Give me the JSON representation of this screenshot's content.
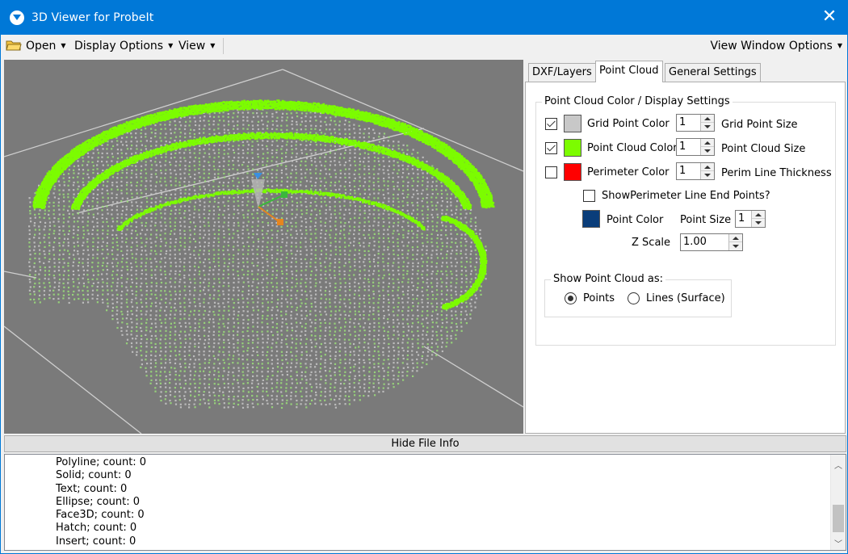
{
  "window": {
    "title": "3D Viewer for ProbeIt",
    "close_glyph": "✕"
  },
  "menu": {
    "open": "Open",
    "display_options": "Display Options",
    "view": "View",
    "view_window_options": "View Window Options"
  },
  "tabs": [
    {
      "label": "DXF/Layers"
    },
    {
      "label": "Point Cloud"
    },
    {
      "label": "General Settings"
    }
  ],
  "active_tab": "Point Cloud",
  "point_cloud": {
    "group_title": "Point Cloud  Color / Display Settings",
    "rows": [
      {
        "checked": true,
        "swatch_color": "#c8c8c8",
        "color_label": "Grid Point Color",
        "size_value": "1",
        "size_label": "Grid Point Size"
      },
      {
        "checked": true,
        "swatch_color": "#7cfc00",
        "color_label": "Point Cloud Color",
        "size_value": "1",
        "size_label": "Point Cloud Size"
      },
      {
        "checked": false,
        "swatch_color": "#ff0000",
        "color_label": "Perimeter Color",
        "size_value": "1",
        "size_label": "Perim Line Thickness"
      }
    ],
    "show_perimeter_end_points": {
      "checked": false,
      "label": "ShowPerimeter Line End Points?"
    },
    "point_color": {
      "swatch_color": "#0a3d7a",
      "label": "Point Color",
      "size_label": "Point Size",
      "size_value": "1"
    },
    "z_scale": {
      "label": "Z Scale",
      "value": "1.00"
    },
    "show_as": {
      "group_title": "Show Point Cloud as:",
      "options": [
        {
          "label": "Points",
          "selected": true
        },
        {
          "label": "Lines (Surface)",
          "selected": false
        }
      ]
    }
  },
  "hide_file_info": "Hide File Info",
  "file_info_lines": [
    "Polyline; count: 0",
    "Solid; count: 0",
    "Text; count: 0",
    "Ellipse; count: 0",
    "Face3D; count: 0",
    "Hatch; count: 0",
    "Insert; count: 0"
  ],
  "colors": {
    "accent": "#0078d7",
    "viewport_bg": "#7a7a7a",
    "cloud_green": "#7cfc00",
    "cloud_grey": "#c8c8c8"
  }
}
